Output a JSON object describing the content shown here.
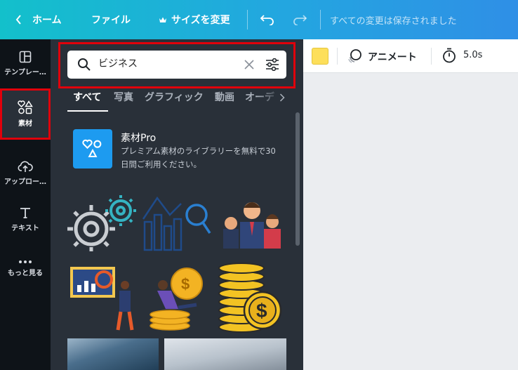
{
  "topbar": {
    "home_label": "ホーム",
    "file_label": "ファイル",
    "resize_label": "サイズを変更",
    "saved_status": "すべての変更は保存されました"
  },
  "rail": {
    "items": [
      {
        "label": "テンプレー…",
        "icon": "template-icon"
      },
      {
        "label": "素材",
        "icon": "elements-icon"
      },
      {
        "label": "アップロー…",
        "icon": "upload-cloud-icon"
      },
      {
        "label": "テキスト",
        "icon": "text-icon"
      },
      {
        "label": "もっと見る",
        "icon": "more-dots-icon"
      }
    ],
    "active_index": 1
  },
  "search": {
    "value": "ビジネス"
  },
  "tabs": [
    {
      "label": "すべて"
    },
    {
      "label": "写真"
    },
    {
      "label": "グラフィック"
    },
    {
      "label": "動画"
    },
    {
      "label": "オーデ"
    }
  ],
  "promo": {
    "title": "素材Pro",
    "description": "プレミアム素材のライブラリーを無料で30日間ご利用ください。"
  },
  "editor_toolbar": {
    "color": "#fddf5a",
    "animate_label": "アニメート",
    "duration": "5.0s"
  },
  "colors": {
    "topbar_start": "#13c0cb",
    "topbar_end": "#2f8fe6",
    "highlight": "#e0000b",
    "rail_bg": "#0e1318",
    "panel_bg": "#293039"
  }
}
